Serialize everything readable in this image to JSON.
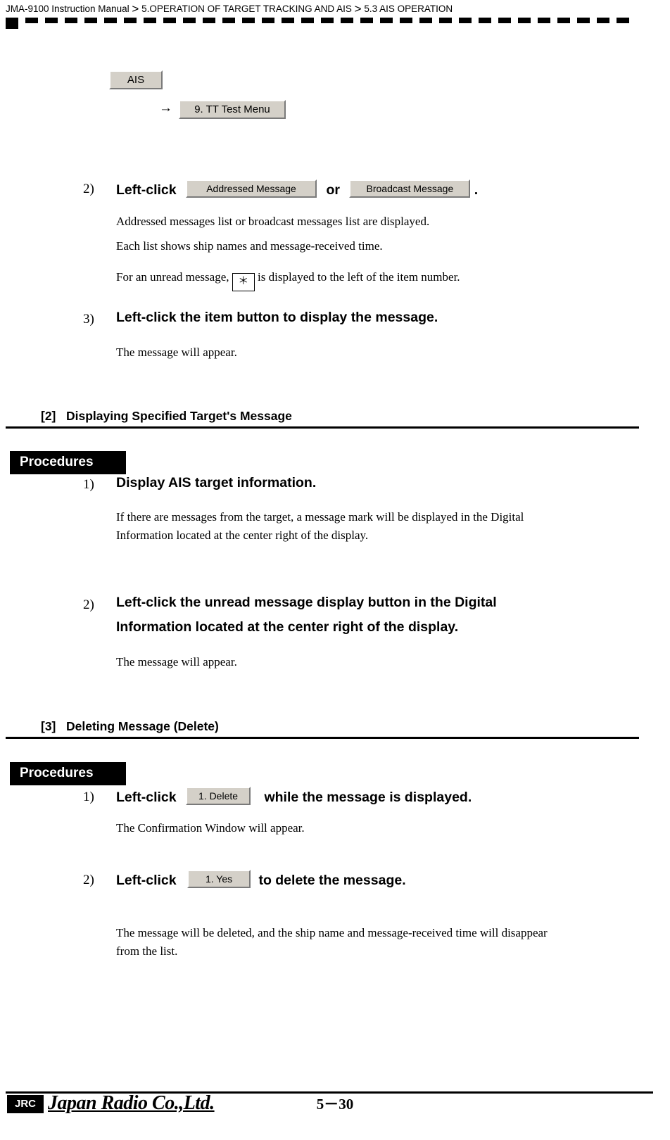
{
  "header": {
    "manual": "JMA-9100 Instruction Manual",
    "sep1": ">",
    "chapter": "5.OPERATION OF TARGET TRACKING AND AIS",
    "sep2": ">",
    "section": "5.3  AIS OPERATION"
  },
  "menu_path": {
    "ais_button": "AIS",
    "arrow": "→",
    "tt_test_menu_button": "9. TT Test Menu"
  },
  "steps_top": {
    "step2": {
      "num": "2)",
      "head_prefix": "Left-click",
      "btn_addressed": "Addressed Message",
      "or": "or",
      "btn_broadcast": "Broadcast Message",
      "period": ".",
      "body_line1": "Addressed messages list or broadcast messages list are displayed.",
      "body_line2": "Each list shows ship names and message-received time.",
      "body_line3_pre": "For an unread message,",
      "unread_mark": "＊",
      "body_line3_post": "is displayed to the left of the item number."
    },
    "step3": {
      "num": "3)",
      "head": "Left-click the item button to display the message.",
      "body": "The message will appear."
    }
  },
  "section2": {
    "tag": "[2]",
    "title": "Displaying Specified Target's Message",
    "procedures_label": "Procedures",
    "step1": {
      "num": "1)",
      "head": "Display AIS target information.",
      "body_line1": "If there are messages from the target, a message mark will be displayed in the Digital",
      "body_line2": "Information located at the center right of the display."
    },
    "step2": {
      "num": "2)",
      "head_line1": "Left-click the unread message display button in the Digital",
      "head_line2": "Information located at the center right of the display.",
      "body": "The message will appear."
    }
  },
  "section3": {
    "tag": "[3]",
    "title": "Deleting Message (Delete)",
    "procedures_label": "Procedures",
    "step1": {
      "num": "1)",
      "head_prefix": "Left-click",
      "btn_delete": "1. Delete",
      "head_suffix": "while the message is displayed.",
      "body": "The Confirmation Window will appear."
    },
    "step2": {
      "num": "2)",
      "head_prefix": "Left-click",
      "btn_yes": "1. Yes",
      "head_suffix": "to delete the message.",
      "body_line1": "The message will be deleted, and the ship name and message-received time will disappear",
      "body_line2": "from the list."
    }
  },
  "footer": {
    "logo": "JRC",
    "company": "Japan Radio Co.,Ltd.",
    "page": "5－30"
  }
}
